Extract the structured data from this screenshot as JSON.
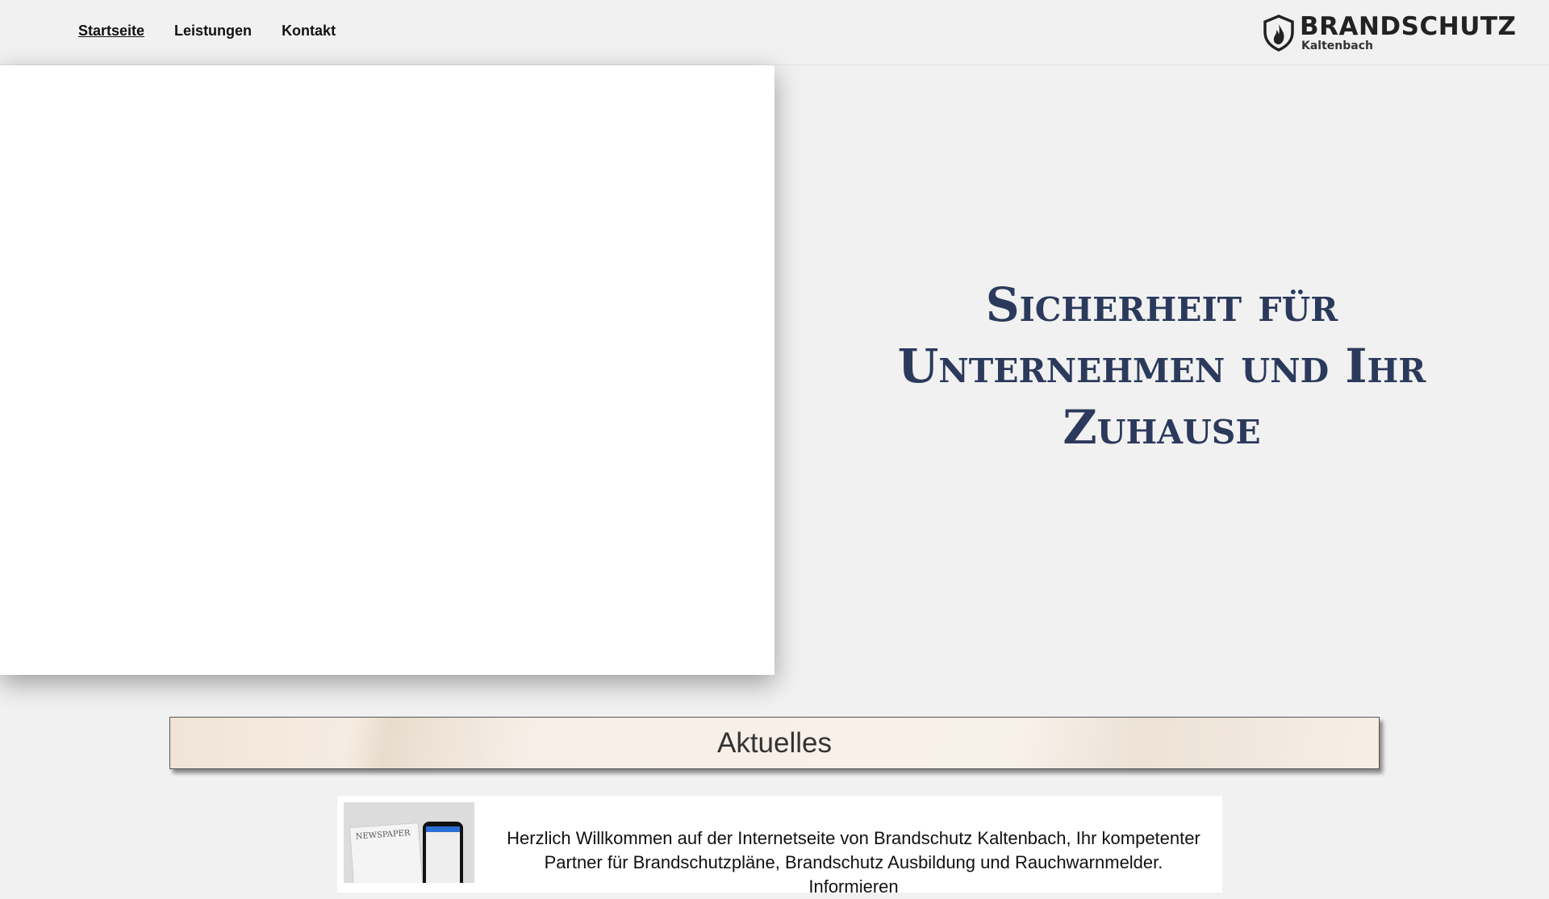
{
  "nav": {
    "items": [
      {
        "label": "Startseite",
        "active": true
      },
      {
        "label": "Leistungen"
      },
      {
        "label": "Kontakt"
      }
    ]
  },
  "logo": {
    "title": "BRANDSCHUTZ",
    "subtitle": "Kaltenbach",
    "icon": "flame-shield-icon"
  },
  "hero": {
    "line1": "Sicherheit für",
    "line2": "Unternehmen und Ihr",
    "line3": "Zuhause"
  },
  "news": {
    "heading": "Aktuelles",
    "image_label": "NEWSPAPER",
    "intro": "Herzlich Willkommen auf der Internetseite von Brandschutz Kaltenbach, Ihr kompetenter Partner für Brandschutzpläne, Brandschutz Ausbildung und Rauchwarnmelder. Informieren"
  },
  "colors": {
    "hero": "#2b3a5c",
    "background": "#f1f1f1"
  }
}
